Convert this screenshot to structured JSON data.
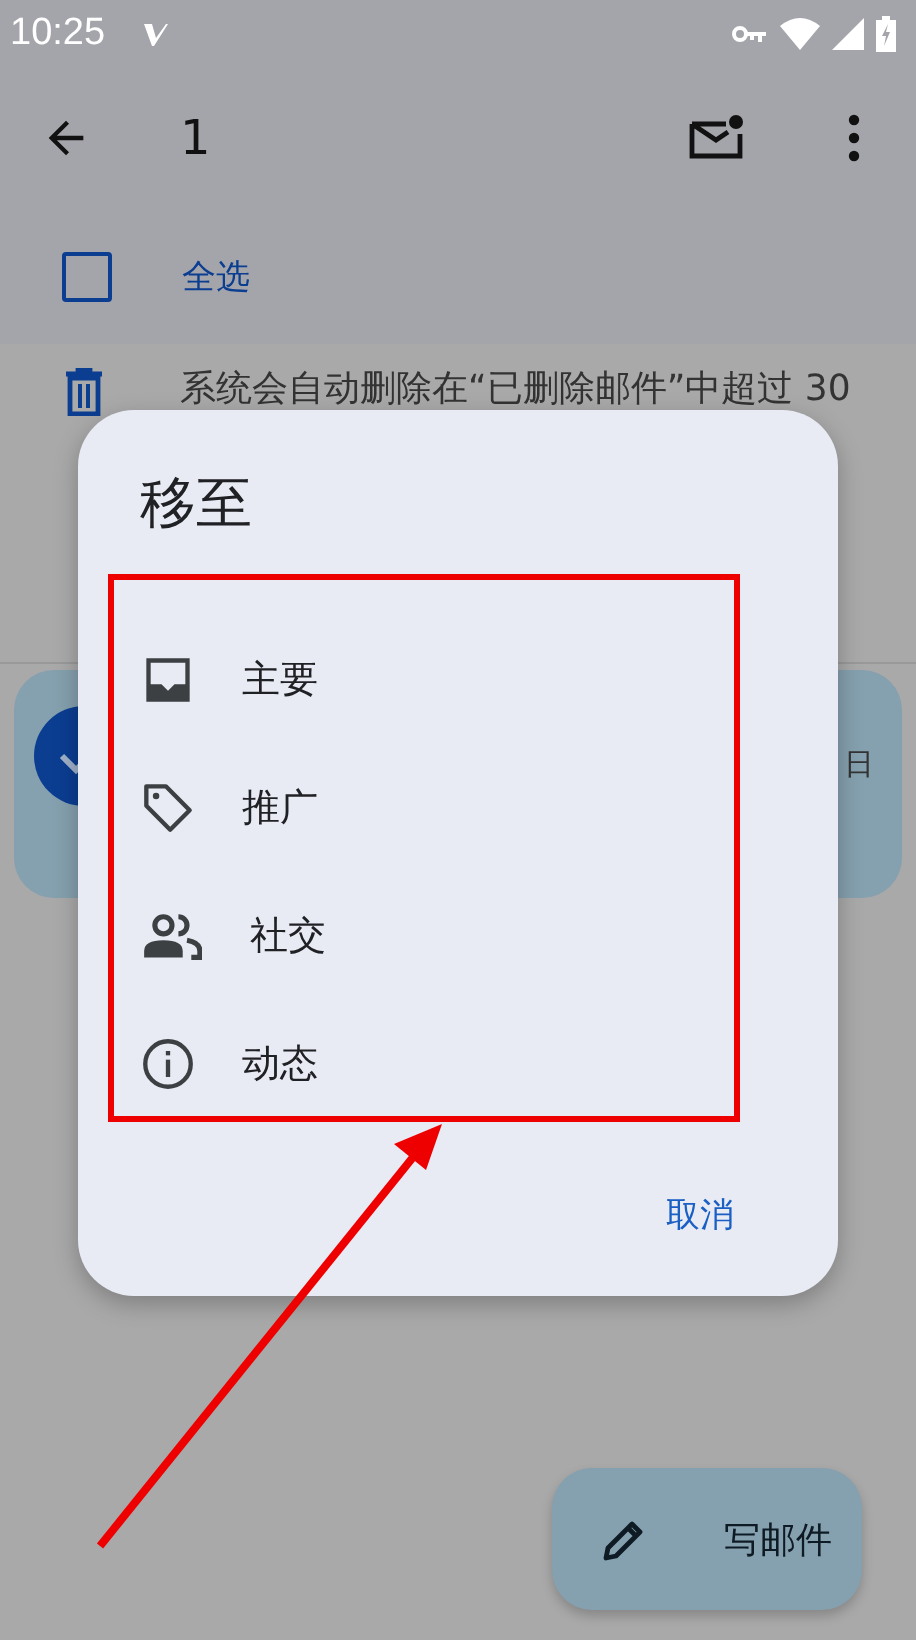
{
  "status_bar": {
    "time": "10:25"
  },
  "app_bar": {
    "title": "1"
  },
  "select_all": {
    "label": "全选",
    "checked": false
  },
  "notice": {
    "text": "系统会自动删除在“已删除邮件”中超过 30"
  },
  "message_card": {
    "date": "日",
    "selected": true
  },
  "dialog": {
    "title": "移至",
    "options": [
      {
        "label": "主要",
        "kind": "inbox"
      },
      {
        "label": "推广",
        "kind": "tag"
      },
      {
        "label": "社交",
        "kind": "people"
      },
      {
        "label": "动态",
        "kind": "info"
      }
    ],
    "cancel": "取消"
  },
  "compose_button": {
    "label": "写邮件"
  }
}
